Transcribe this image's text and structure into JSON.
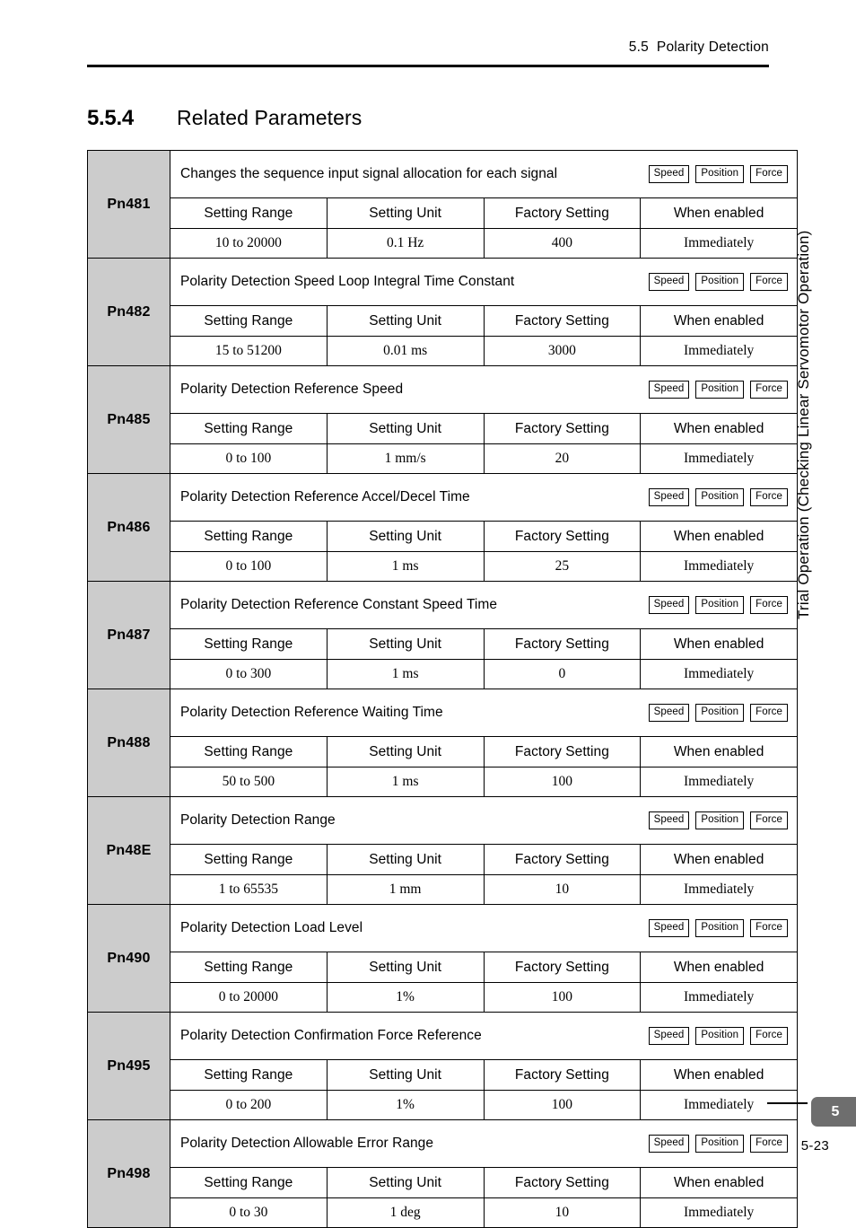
{
  "header": {
    "running_head": "5.5  Polarity Detection"
  },
  "section": {
    "number": "5.5.4",
    "title": "Related Parameters"
  },
  "table": {
    "columns": [
      "Setting Range",
      "Setting Unit",
      "Factory Setting",
      "When enabled"
    ],
    "badge_labels": [
      "Speed",
      "Position",
      "Force"
    ],
    "rows": [
      {
        "code": "Pn481",
        "description": "Changes the sequence input signal allocation for each signal",
        "setting_range": "10 to 20000",
        "setting_unit": "0.1 Hz",
        "factory_setting": "400",
        "when_enabled": "Immediately"
      },
      {
        "code": "Pn482",
        "description": "Polarity Detection Speed Loop Integral Time Constant",
        "setting_range": "15 to 51200",
        "setting_unit": "0.01 ms",
        "factory_setting": "3000",
        "when_enabled": "Immediately"
      },
      {
        "code": "Pn485",
        "description": "Polarity Detection Reference Speed",
        "setting_range": "0 to 100",
        "setting_unit": "1 mm/s",
        "factory_setting": "20",
        "when_enabled": "Immediately"
      },
      {
        "code": "Pn486",
        "description": "Polarity Detection Reference Accel/Decel Time",
        "setting_range": "0 to 100",
        "setting_unit": "1 ms",
        "factory_setting": "25",
        "when_enabled": "Immediately"
      },
      {
        "code": "Pn487",
        "description": "Polarity Detection Reference Constant Speed Time",
        "setting_range": "0 to 300",
        "setting_unit": "1 ms",
        "factory_setting": "0",
        "when_enabled": "Immediately"
      },
      {
        "code": "Pn488",
        "description": "Polarity Detection Reference Waiting Time",
        "setting_range": "50 to 500",
        "setting_unit": "1 ms",
        "factory_setting": "100",
        "when_enabled": "Immediately"
      },
      {
        "code": "Pn48E",
        "description": "Polarity Detection Range",
        "setting_range": "1 to 65535",
        "setting_unit": "1 mm",
        "factory_setting": "10",
        "when_enabled": "Immediately"
      },
      {
        "code": "Pn490",
        "description": "Polarity Detection Load Level",
        "setting_range": "0 to 20000",
        "setting_unit": "1%",
        "factory_setting": "100",
        "when_enabled": "Immediately"
      },
      {
        "code": "Pn495",
        "description": "Polarity Detection Confirmation Force Reference",
        "setting_range": "0 to 200",
        "setting_unit": "1%",
        "factory_setting": "100",
        "when_enabled": "Immediately"
      },
      {
        "code": "Pn498",
        "description": "Polarity Detection Allowable Error Range",
        "setting_range": "0 to 30",
        "setting_unit": "1 deg",
        "factory_setting": "10",
        "when_enabled": "Immediately"
      }
    ]
  },
  "side_tab": {
    "chapter_title": "Trial Operation (Checking Linear Servomotor Operation)",
    "chapter_number": "5"
  },
  "footer": {
    "page_number": "5-23"
  },
  "colors": {
    "code_cell_background": "#cccccc",
    "chapter_tab_background": "#6e6e6e",
    "rule": "#000000"
  }
}
